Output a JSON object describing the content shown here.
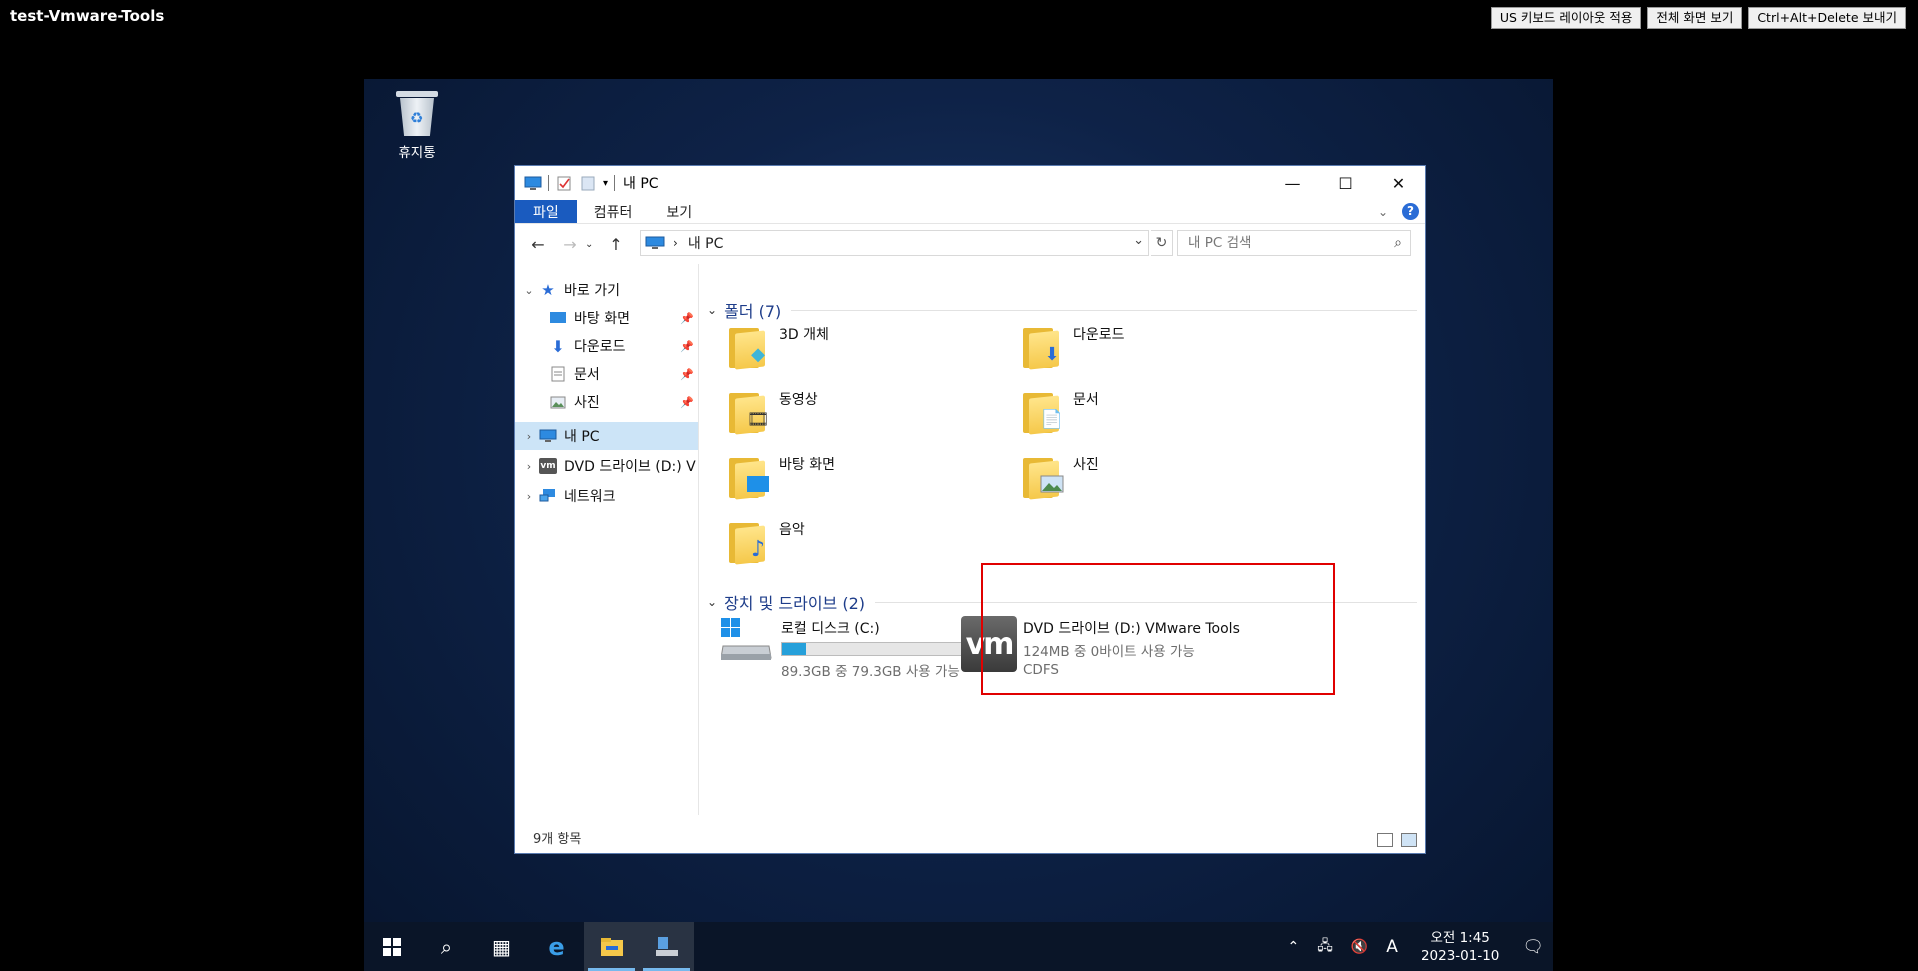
{
  "console": {
    "title": "test-Vmware-Tools",
    "buttons": [
      "US 키보드 레이아웃 적용",
      "전체 화면 보기",
      "Ctrl+Alt+Delete 보내기"
    ]
  },
  "desktop": {
    "recycle_bin_label": "휴지통"
  },
  "window": {
    "title": "내 PC",
    "ribbon_tabs": [
      "파일",
      "컴퓨터",
      "보기"
    ],
    "help": "?",
    "address": "내 PC",
    "search_placeholder": "내 PC 검색",
    "quick_access": {
      "label": "바로 가기",
      "items": [
        {
          "label": "바탕 화면"
        },
        {
          "label": "다운로드"
        },
        {
          "label": "문서"
        },
        {
          "label": "사진"
        }
      ]
    },
    "nav_pc": "내 PC",
    "nav_dvd": "DVD 드라이브 (D:) V",
    "nav_network": "네트워크",
    "folders_header": "폴더 (7)",
    "folders": [
      "3D 개체",
      "다운로드",
      "동영상",
      "문서",
      "바탕 화면",
      "사진",
      "음악"
    ],
    "devices_header": "장치 및 드라이브 (2)",
    "drive_c": {
      "name": "로컬 디스크 (C:)",
      "space": "89.3GB 중 79.3GB 사용 가능",
      "used_fraction": 0.112
    },
    "drive_d": {
      "name": "DVD 드라이브 (D:) VMware Tools",
      "space": "124MB 중 0바이트 사용 가능",
      "fs": "CDFS",
      "logo": "vm"
    },
    "status": "9개 항목"
  },
  "taskbar": {
    "time": "오전 1:45",
    "date": "2023-01-10",
    "ime": "A"
  },
  "colors": {
    "accent": "#1a5bbf",
    "highlight": "#e00000",
    "bar_fill": "#26a0da"
  }
}
